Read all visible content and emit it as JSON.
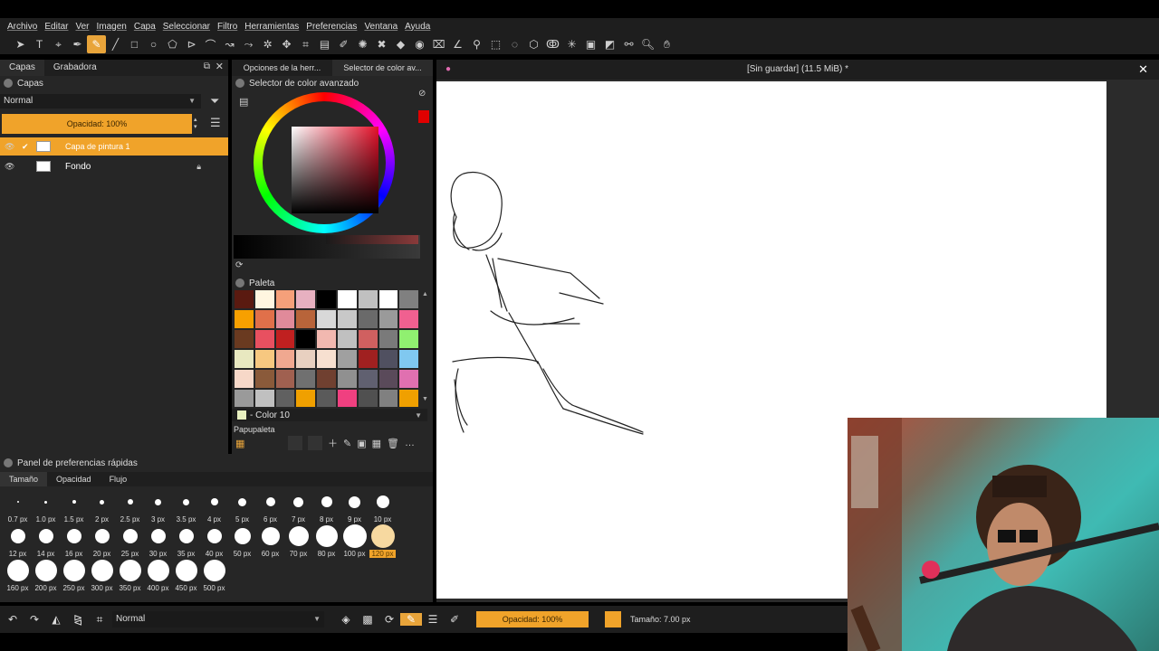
{
  "menu": [
    "Archivo",
    "Editar",
    "Ver",
    "Imagen",
    "Capa",
    "Seleccionar",
    "Filtro",
    "Herramientas",
    "Preferencias",
    "Ventana",
    "Ayuda"
  ],
  "toolbar_icons": [
    "select-icon",
    "text-icon",
    "edit-shape-icon",
    "calligraphy-icon",
    "brush-icon",
    "line-icon",
    "rectangle-icon",
    "ellipse-icon",
    "polygon-icon",
    "polyline-icon",
    "bezier-icon",
    "freehand-path-icon",
    "dynamic-brush-icon",
    "multibrush-icon",
    "move-icon",
    "crop-icon",
    "gradient-icon",
    "color-sampler-icon",
    "colorize-mask-icon",
    "smart-patch-icon",
    "fill-icon",
    "enclose-fill-icon",
    "assistant-icon",
    "measure-icon",
    "reference-icon",
    "rect-select-icon",
    "ellipse-select-icon",
    "polygon-select-icon",
    "freehand-select-icon",
    "contiguous-select-icon",
    "similar-select-icon",
    "bezier-select-icon",
    "magnetic-select-icon",
    "zoom-icon",
    "pan-icon"
  ],
  "left": {
    "tabs": [
      "Capas",
      "Grabadora"
    ],
    "panel_title": "Capas",
    "blend_mode": "Normal",
    "opacity": "Opacidad: 100%",
    "layers": [
      {
        "name": "Capa de pintura 1",
        "selected": true
      },
      {
        "name": "Fondo",
        "selected": false
      }
    ]
  },
  "middle": {
    "tabs": [
      "Opciones de la herr...",
      "Selector de color av..."
    ],
    "panel_title": "Selector de color avanzado",
    "palette_title": "Paleta",
    "color_name": "- Color 10",
    "papupaleta": "Papupaleta",
    "palette_colors": [
      "#5a1a10",
      "#fff6e0",
      "#f5a07a",
      "#e7b0c0",
      "#000000",
      "#ffffff",
      "#c0c0c0",
      "#ffffff",
      "#808080",
      "#f7a000",
      "#e0704a",
      "#e08a9a",
      "#b8643a",
      "#d8d8d8",
      "#c8c8c8",
      "#6a6a6a",
      "#9a9a9a",
      "#f06090",
      "#6a3a20",
      "#e85060",
      "#c02020",
      "#000000",
      "#f2b8b0",
      "#c0c0c0",
      "#d06060",
      "#7a7a7a",
      "#90f070",
      "#e8e8c0",
      "#f7c880",
      "#f0a890",
      "#e8d0c0",
      "#f7e0d0",
      "#a0a0a0",
      "#a02020",
      "#505060",
      "#80c8f0",
      "#f7d8c8",
      "#8a5a3a",
      "#a06050",
      "#707070",
      "#704030",
      "#909090",
      "#606070",
      "#5a4a5a",
      "#e070b0",
      "#9a9a9a",
      "#c0c0c0",
      "#606060",
      "#f0a000",
      "#5a5a5a",
      "#f04080",
      "#505050",
      "#808080",
      "#f0a000"
    ]
  },
  "quick": {
    "title": "Panel de preferencias rápidas",
    "tabs": [
      "Tamaño",
      "Opacidad",
      "Flujo"
    ],
    "row1": [
      "0.7 px",
      "1.0 px",
      "1.5 px",
      "2 px",
      "2.5 px",
      "3 px",
      "3.5 px",
      "4 px",
      "5 px",
      "6 px",
      "7 px",
      "8 px",
      "9 px",
      "10 px"
    ],
    "row2": [
      "12 px",
      "14 px",
      "16 px",
      "20 px",
      "25 px",
      "30 px",
      "35 px",
      "40 px",
      "50 px",
      "60 px",
      "70 px",
      "80 px",
      "100 px",
      "120 px"
    ],
    "row3": [
      "160 px",
      "200 px",
      "250 px",
      "300 px",
      "350 px",
      "400 px",
      "450 px",
      "500 px"
    ]
  },
  "canvas": {
    "title": "[Sin guardar]  (11.5 MiB) *"
  },
  "bottom": {
    "blend_mode": "Normal",
    "opacity": "Opacidad: 100%",
    "size": "Tamaño: 7.00 px"
  }
}
